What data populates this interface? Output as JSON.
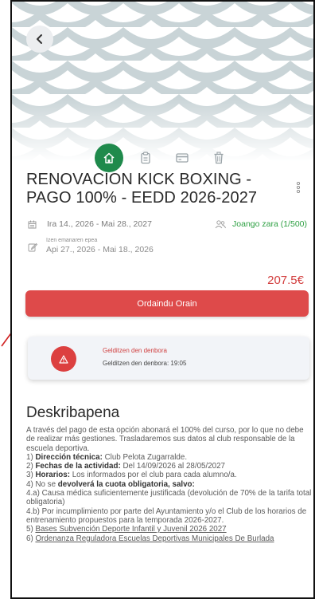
{
  "event": {
    "title": "RENOVACION KICK BOXING - PAGO 100% - EEDD 2026-2027",
    "dates": "Ira 14., 2026 - Mai 28., 2027",
    "participants": "Joango zara (1/500)",
    "registration_label": "Izen emanaren epea",
    "registration_range": "Api 27., 2026 - Mai 18., 2026",
    "price": "207.5€"
  },
  "pay_button": {
    "label": "Ordaindu Orain"
  },
  "alert": {
    "title": "Gelditzen den denbora",
    "text": "Gelditzen den denbora: 19:05"
  },
  "description": {
    "heading": "Deskribapena",
    "intro": "A través del pago de esta opción abonará el 100% del curso, por lo que no debe de realizar más gestiones. Trasladaremos sus datos al club responsable de la escuela deportiva.",
    "l1_label": "Dirección técnica:",
    "l1_value": "Club Pelota Zugarralde.",
    "l2_label": "Fechas de la actividad:",
    "l2_value": "Del 14/09/2026 al 28/05/2027",
    "l3_label": "Horarios:",
    "l3_value": "Los informados por el club para cada alumno/a.",
    "l4_pre": "No se",
    "l4_label": "devolverá la cuota obligatoria, salvo:",
    "l4a": "4.a) Causa médica suficientemente justificada (devolución de 70% de la tarifa total obligatoria)",
    "l4b": "4.b) Por incumplimiento por parte del Ayuntamiento y/o el Club de los horarios de entrenamiento propuestos para la temporada 2026-2027.",
    "l5": "Bases Subvención Deporte Infantil y Juvenil 2026 2027",
    "l6": "Ordenanza Reguladora Escuelas Deportivas Municipales De Burlada"
  },
  "colors": {
    "accent_green": "#1f8a4c",
    "danger": "#de4a4a",
    "price": "#d23c3c"
  }
}
